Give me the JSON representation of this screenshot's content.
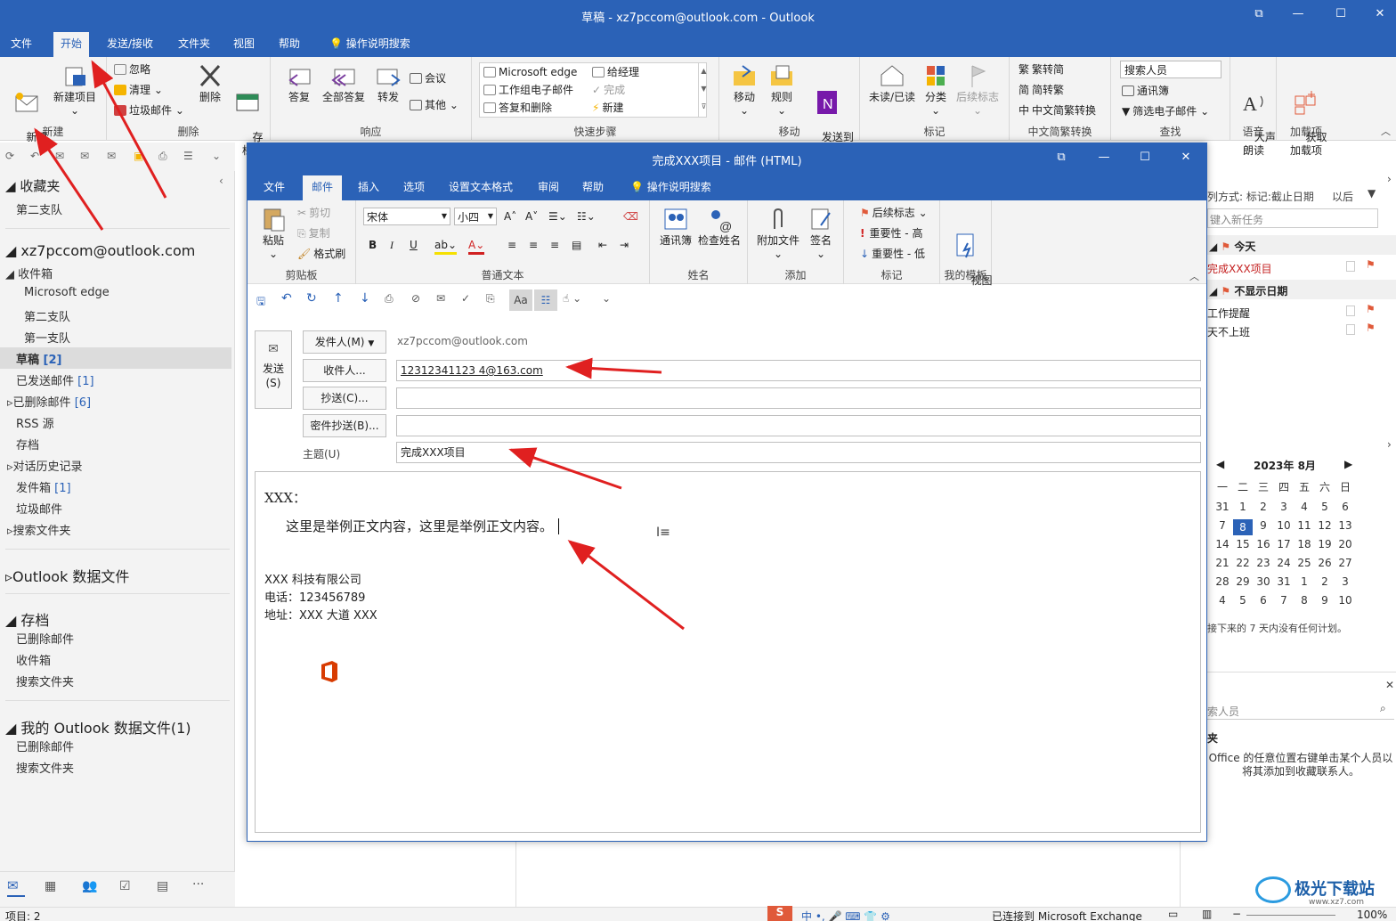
{
  "window": {
    "title": "草稿 - xz7pccom@outlook.com - Outlook"
  },
  "menu": {
    "tabs": [
      "文件",
      "开始",
      "发送/接收",
      "文件夹",
      "视图",
      "帮助"
    ],
    "tell_me": "操作说明搜索"
  },
  "ribbon": {
    "new": {
      "new_email": "新建\n电子邮件",
      "new_item": "新建项目",
      "group": "新建"
    },
    "delete": {
      "ignore": "忽略",
      "cleanup": "清理",
      "junk": "垃圾邮件",
      "delete": "删除",
      "archive": "存\n档",
      "group": "删除"
    },
    "respond": {
      "reply": "答复",
      "reply_all": "全部答复",
      "forward": "转发",
      "meeting": "会议",
      "more": "其他",
      "group": "响应"
    },
    "quicksteps": {
      "items": [
        "Microsoft edge",
        "给经理",
        "工作组电子邮件",
        "完成",
        "答复和删除",
        "新建"
      ],
      "group": "快速步骤"
    },
    "move": {
      "move": "移动",
      "rules": "规则",
      "onenote": "发送到\nOneNote",
      "group": "移动"
    },
    "tags": {
      "read_unread": "未读/已读",
      "categorize": "分类",
      "followup": "后续标志",
      "group": "标记"
    },
    "convert": {
      "t2s": "繁转简",
      "s2t": "简转繁",
      "conv": "中文简繁转换",
      "group": "中文简繁转换"
    },
    "find": {
      "search_people": "搜索人员",
      "address_book": "通讯簿",
      "filter": "筛选电子邮件",
      "group": "查找"
    },
    "speech": {
      "read_aloud": "大声\n朗读",
      "group": "语音"
    },
    "addins": {
      "get": "获取\n加载项",
      "group": "加载项"
    }
  },
  "nav": {
    "favorites": "收藏夹",
    "fav_items": [
      "第二支队"
    ],
    "account": "xz7pccom@outlook.com",
    "inbox": "收件箱",
    "inbox_children": [
      "Microsoft edge",
      "第二支队",
      "第一支队"
    ],
    "drafts": "草稿",
    "drafts_count": "[2]",
    "sent": "已发送邮件",
    "sent_count": "[1]",
    "deleted": "已删除邮件",
    "deleted_count": "[6]",
    "rss": "RSS 源",
    "archive": "存档",
    "conv_history": "对话历史记录",
    "outbox": "发件箱",
    "outbox_count": "[1]",
    "junk": "垃圾邮件",
    "search_folders": "搜索文件夹",
    "data_file": "Outlook 数据文件",
    "archive_root": "存档",
    "archive_items": [
      "已删除邮件",
      "收件箱",
      "搜索文件夹"
    ],
    "my_data": "我的 Outlook 数据文件(1)",
    "my_data_items": [
      "已删除邮件",
      "搜索文件夹"
    ]
  },
  "status": {
    "items": "项目: 2",
    "connected": "已连接到 Microsoft Exchange",
    "zoom": "100%"
  },
  "todo": {
    "sort": "列方式: 标记:截止日期",
    "order": "以后",
    "new_task": "键入新任务",
    "today": "今天",
    "today_item": "完成XXX项目",
    "no_date": "不显示日期",
    "no_date_items": [
      "工作提醒",
      "天不上班"
    ],
    "calendar_month": "2023年 8月",
    "weekdays": [
      "一",
      "二",
      "三",
      "四",
      "五",
      "六",
      "日"
    ],
    "weeks": [
      [
        "31",
        "1",
        "2",
        "3",
        "4",
        "5",
        "6"
      ],
      [
        "7",
        "8",
        "9",
        "10",
        "11",
        "12",
        "13"
      ],
      [
        "14",
        "15",
        "16",
        "17",
        "18",
        "19",
        "20"
      ],
      [
        "21",
        "22",
        "23",
        "24",
        "25",
        "26",
        "27"
      ],
      [
        "28",
        "29",
        "30",
        "31",
        "1",
        "2",
        "3"
      ],
      [
        "4",
        "5",
        "6",
        "7",
        "8",
        "9",
        "10"
      ]
    ],
    "today_day": "8",
    "no_plans": "接下来的 7 天内没有任何计划。",
    "people_search": "索人员",
    "fav_heading": "夹",
    "fav_hint": "Office 的任意位置右键单击某个人员以将其添加到收藏联系人。"
  },
  "compose": {
    "title": "完成XXX项目 - 邮件 (HTML)",
    "tabs": [
      "文件",
      "邮件",
      "插入",
      "选项",
      "设置文本格式",
      "审阅",
      "帮助"
    ],
    "tell_me": "操作说明搜索",
    "clipboard": {
      "paste": "粘贴",
      "cut": "剪切",
      "copy": "复制",
      "painter": "格式刷",
      "group": "剪贴板"
    },
    "font": {
      "name": "宋体",
      "size": "小四",
      "group": "普通文本"
    },
    "names": {
      "address_book": "通讯簿",
      "check_names": "检查姓名",
      "group": "姓名"
    },
    "include": {
      "attach": "附加文件",
      "signature": "签名",
      "group": "添加"
    },
    "tags": {
      "followup": "后续标志",
      "high": "重要性 - 高",
      "low": "重要性 - 低",
      "group": "标记"
    },
    "templates": {
      "view": "视图\n模板",
      "group": "我的模板"
    },
    "send": "发送\n(S)",
    "from_btn": "发件人(M)",
    "from_value": "xz7pccom@outlook.com",
    "to_btn": "收件人...",
    "to_value": "12312341123 4@163.com",
    "cc_btn": "抄送(C)...",
    "bcc_btn": "密件抄送(B)...",
    "subject_label": "主题(U)",
    "subject_value": "完成XXX项目",
    "body_greeting": "XXX：",
    "body_text": "这里是举例正文内容，这里是举例正文内容。",
    "sig_company": "XXX 科技有限公司",
    "sig_phone": "电话：123456789",
    "sig_address": "地址：XXX 大道 XXX"
  },
  "watermark": "极光下载站",
  "watermark_url": "www.xz7.com",
  "colors": {
    "brand": "#2b62b7",
    "arrow": "#e02020",
    "flag": "#e05a3a"
  }
}
